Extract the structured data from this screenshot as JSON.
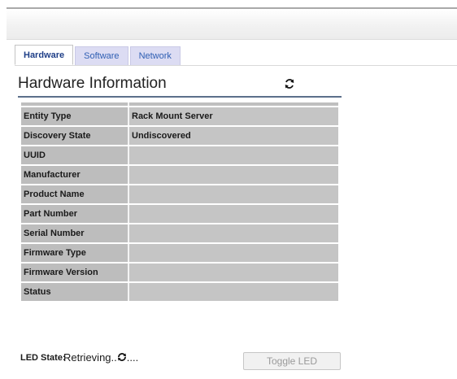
{
  "tabs": [
    {
      "label": "Hardware",
      "active": true
    },
    {
      "label": "Software",
      "active": false
    },
    {
      "label": "Network",
      "active": false
    }
  ],
  "section": {
    "title": "Hardware Information",
    "refresh_icon": "refresh-icon"
  },
  "hardware_table": {
    "rows": [
      {
        "label": "Entity Type",
        "value": "Rack Mount Server"
      },
      {
        "label": "Discovery State",
        "value": "Undiscovered"
      },
      {
        "label": "UUID",
        "value": ""
      },
      {
        "label": "Manufacturer",
        "value": ""
      },
      {
        "label": "Product Name",
        "value": ""
      },
      {
        "label": "Part Number",
        "value": ""
      },
      {
        "label": "Serial Number",
        "value": ""
      },
      {
        "label": "Firmware Type",
        "value": ""
      },
      {
        "label": "Firmware Version",
        "value": ""
      },
      {
        "label": "Status",
        "value": ""
      }
    ]
  },
  "led": {
    "label": "LED State:",
    "value_prefix": "Retrieving..",
    "value_suffix": "....",
    "spinner_icon": "loading-spinner-icon",
    "toggle_label": "Toggle LED",
    "toggle_disabled": true
  },
  "colors": {
    "tab_inactive_bg": "#dcdcf3",
    "tab_text": "#2f5fb3",
    "table_cell_bg": "#c5c5c5",
    "title_rule": "#5c6f8a"
  }
}
